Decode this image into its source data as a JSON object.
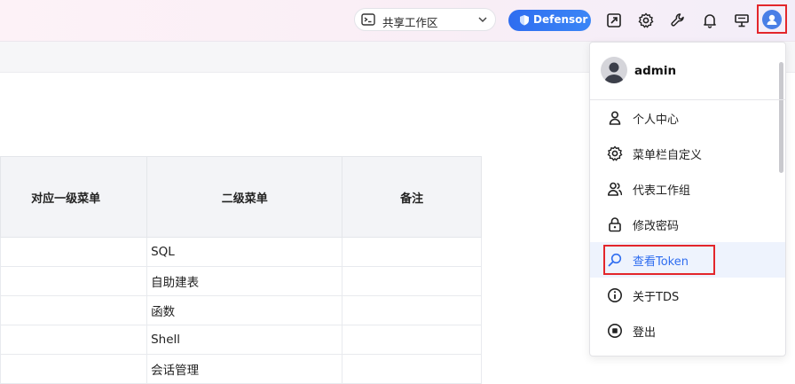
{
  "header": {
    "workspace_label": "共享工作区",
    "defensor_label": "Defensor",
    "icons": [
      "terminal-icon",
      "chevron-down-icon",
      "shield-icon",
      "send-icon",
      "gear-icon",
      "wrench-icon",
      "bell-icon",
      "monitor-icon",
      "avatar-icon"
    ]
  },
  "table": {
    "headers": [
      "对应一级菜单",
      "二级菜单",
      "备注"
    ],
    "rows": [
      [
        "",
        "SQL",
        ""
      ],
      [
        "",
        "自助建表",
        ""
      ],
      [
        "",
        "函数",
        ""
      ],
      [
        "",
        "Shell",
        ""
      ],
      [
        "",
        "会话管理",
        ""
      ]
    ]
  },
  "user_menu": {
    "username": "admin",
    "items": [
      {
        "label": "个人中心",
        "icon": "person-icon"
      },
      {
        "label": "菜单栏自定义",
        "icon": "gear-icon"
      },
      {
        "label": "代表工作组",
        "icon": "group-icon"
      },
      {
        "label": "修改密码",
        "icon": "lock-icon"
      },
      {
        "label": "查看Token",
        "icon": "search-icon"
      },
      {
        "label": "关于TDS",
        "icon": "info-icon"
      },
      {
        "label": "登出",
        "icon": "stop-icon"
      }
    ]
  },
  "colors": {
    "accent": "#2f6df0",
    "highlight": "#e3262b"
  }
}
